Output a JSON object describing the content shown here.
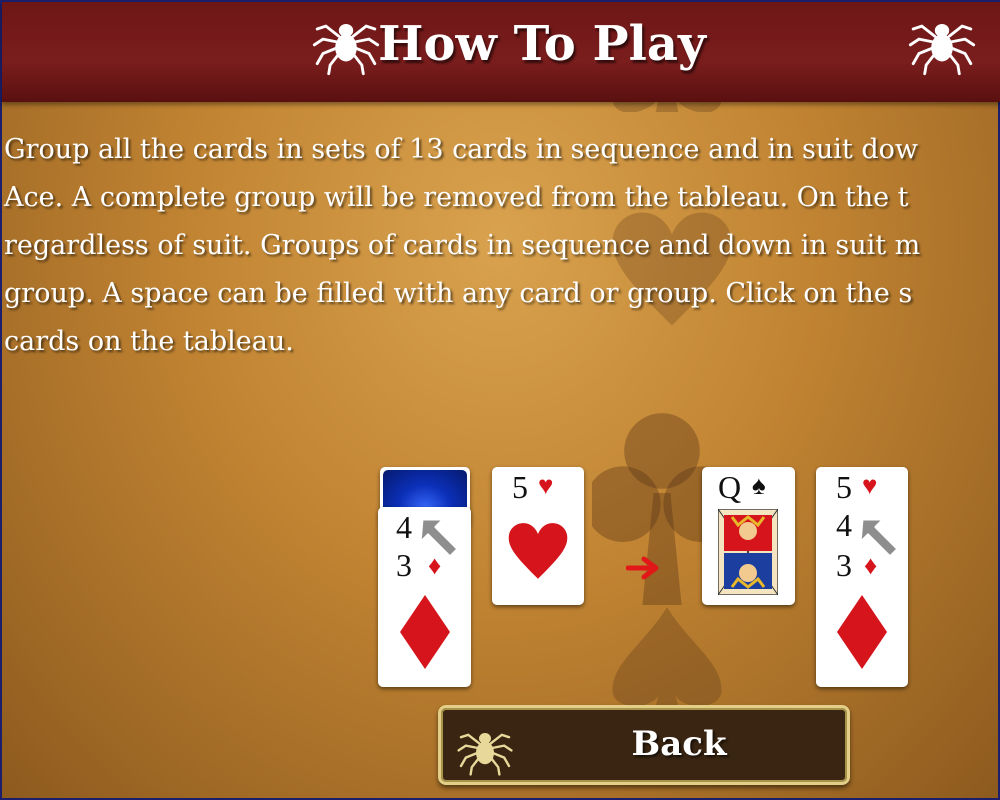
{
  "header": {
    "title": "How To Play"
  },
  "instructions": {
    "lines": [
      "Group all the cards in sets of 13 cards in sequence and in suit dow",
      "Ace. A complete group will be removed from the tableau. On the t",
      "regardless of suit. Groups of cards in sequence and down in suit m",
      "group. A space can be filled with any card or group. Click on the s",
      "cards on the tableau."
    ]
  },
  "demo": {
    "left_stack": {
      "ranks": [
        "4",
        "3"
      ],
      "suit": "diamond",
      "color": "#d6141c"
    },
    "target_before": {
      "rank": "5",
      "suit": "heart",
      "color": "#d6141c"
    },
    "queen": {
      "rank": "Q",
      "suit": "spade",
      "color": "#111111"
    },
    "result_stack": {
      "ranks": [
        "5",
        "4",
        "3"
      ],
      "suits": [
        "heart",
        "diamond",
        "diamond"
      ],
      "color": "#d6141c"
    }
  },
  "back_button": {
    "label": "Back"
  },
  "colors": {
    "header_bg": "#7a1d1d",
    "table_bg": "#c08332",
    "button_bg": "#3a2512",
    "button_border": "#e3cf87"
  },
  "icons": [
    "spider-icon",
    "club-watermark-icon",
    "spade-watermark-icon",
    "heart-watermark-icon",
    "cursor-arrow-icon",
    "move-arrow-icon"
  ]
}
